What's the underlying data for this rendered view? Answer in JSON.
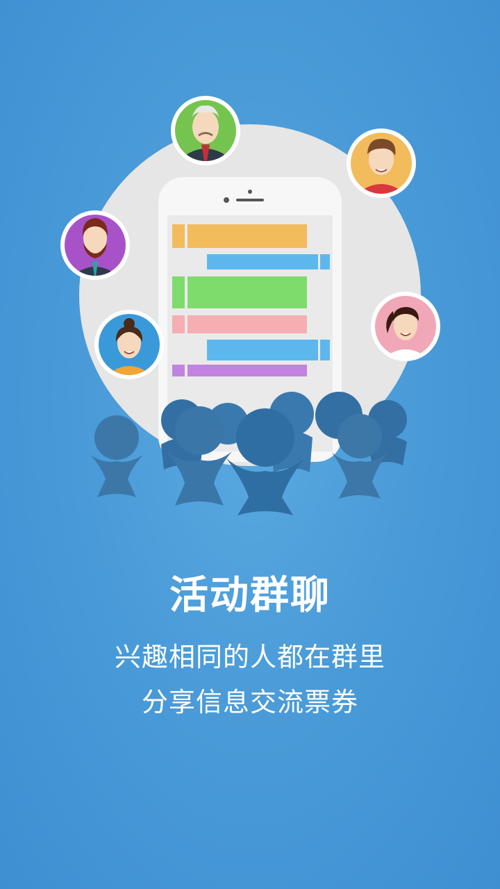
{
  "colors": {
    "background": "#4a9bd8",
    "big_circle": "#e6e6e6",
    "phone_body": "#f5f5f5",
    "screen": "#eaeaea",
    "bar_orange": "#f2bb5c",
    "bar_blue": "#5cb8ec",
    "bar_green": "#7ddc6c",
    "bar_pink": "#f5aeb1",
    "bar_purple": "#c083e0",
    "crowd": "#2f6ea3"
  },
  "avatars": [
    {
      "name": "elderly-man",
      "ring": "#76c450"
    },
    {
      "name": "young-man",
      "ring": "#f2bb5c"
    },
    {
      "name": "bearded-man",
      "ring": "#a852c9"
    },
    {
      "name": "woman-bun",
      "ring": "#3a9ad9"
    },
    {
      "name": "woman-ponytail",
      "ring": "#f0a8b8"
    }
  ],
  "title": "活动群聊",
  "subtitle_line1": "兴趣相同的人都在群里",
  "subtitle_line2": "分享信息交流票券"
}
